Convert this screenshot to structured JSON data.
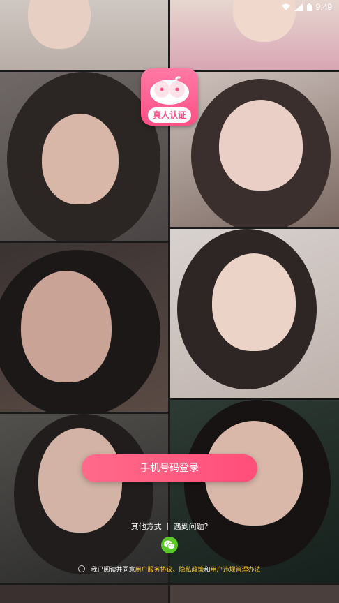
{
  "status_bar": {
    "time": "9:49"
  },
  "logo": {
    "label": "真人认证"
  },
  "login": {
    "phone_login_label": "手机号码登录"
  },
  "other": {
    "other_methods_label": "其他方式",
    "help_label": "遇到问题?"
  },
  "agreement": {
    "prefix": "我已阅读并同意",
    "user_agreement": "用户服务协议",
    "sep1": "、",
    "privacy_policy": "隐私政策",
    "and": "和",
    "conduct_rules": "用户违规管理办法"
  },
  "colors": {
    "accent": "#ff4e7a",
    "link": "#ffcc33",
    "wechat": "#5ac82a"
  },
  "icons": [
    "wifi-icon",
    "signal-icon",
    "battery-icon",
    "wechat-icon"
  ]
}
